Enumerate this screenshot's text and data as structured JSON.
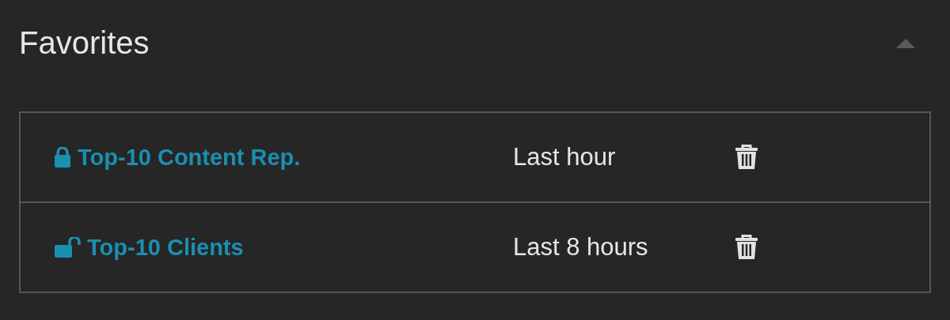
{
  "panel": {
    "title": "Favorites",
    "expanded": true
  },
  "favorites": [
    {
      "name": "Top-10 Content Rep.",
      "locked": true,
      "period": "Last hour"
    },
    {
      "name": "Top-10 Clients",
      "locked": false,
      "period": "Last 8 hours"
    }
  ]
}
